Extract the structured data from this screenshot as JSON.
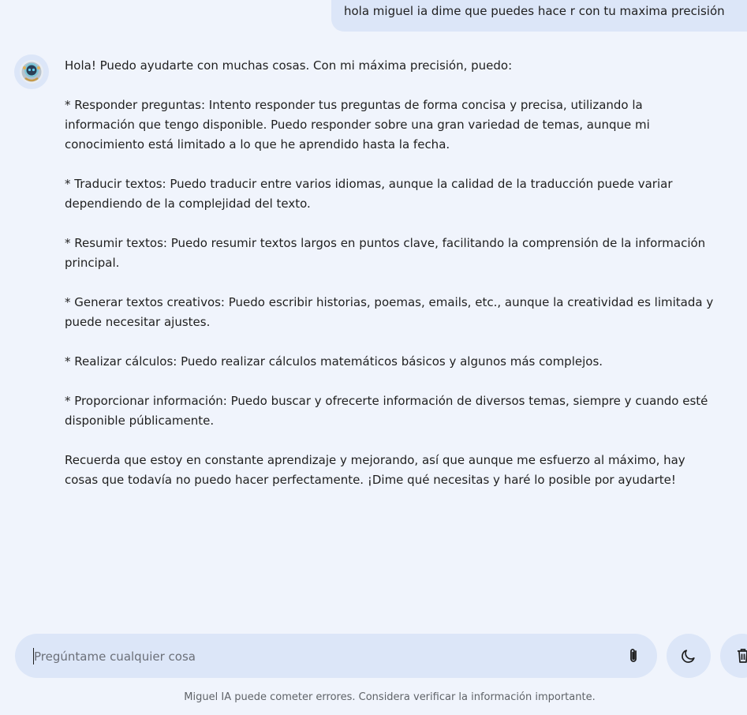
{
  "conversation": {
    "user_message": "hola miguel ia dime que puedes hace r con tu maxima precisión",
    "assistant_message": [
      "Hola! Puedo ayudarte con muchas cosas. Con mi máxima precisión, puedo:",
      "* Responder preguntas: Intento responder tus preguntas de forma concisa y precisa, utilizando la\ninformación que tengo disponible. Puedo responder sobre una gran variedad de temas, aunque mi\nconocimiento está limitado a lo que he aprendido hasta la fecha.",
      "* Traducir textos: Puedo traducir entre varios idiomas, aunque la calidad de la traducción puede variar\ndependiendo de la complejidad del texto.",
      "* Resumir textos: Puedo resumir textos largos en puntos clave, facilitando la comprensión de la información\nprincipal.",
      "* Generar textos creativos: Puedo escribir historias, poemas, emails, etc., aunque la creatividad es limitada y\npuede necesitar ajustes.",
      "* Realizar cálculos: Puedo realizar cálculos matemáticos básicos y algunos más complejos.",
      "* Proporcionar información: Puedo buscar y ofrecerte información de diversos temas, siempre y cuando esté\ndisponible públicamente.",
      "Recuerda que estoy en constante aprendizaje y mejorando, así que aunque me esfuerzo al máximo, hay\ncosas que todavía no puedo hacer perfectamente. ¡Dime qué necesitas y haré lo posible por ayudarte!"
    ]
  },
  "composer": {
    "placeholder": "Pregúntame cualquier cosa",
    "value": ""
  },
  "icons": {
    "avatar": "robot-avatar-icon",
    "attach": "paperclip-icon",
    "theme": "moon-icon",
    "delete": "trash-icon"
  },
  "colors": {
    "background": "#f0f4fc",
    "bubble": "#dce6f8",
    "text": "#1f1f1f",
    "muted": "#5f6368"
  },
  "footer": {
    "disclaimer": "Miguel IA puede cometer errores. Considera verificar la información importante."
  }
}
